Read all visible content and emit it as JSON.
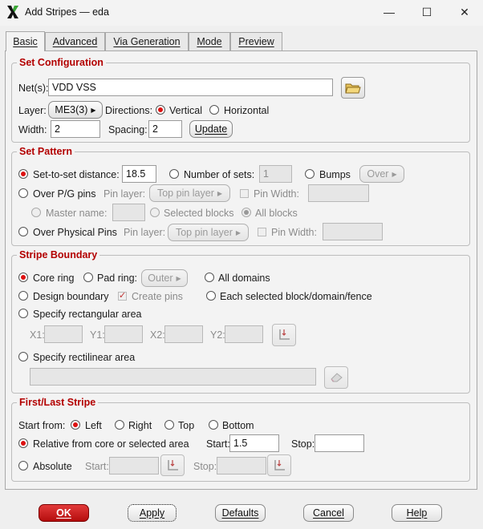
{
  "window": {
    "title": "Add Stripes — eda",
    "minimize": "—",
    "maximize": "☐",
    "close": "✕"
  },
  "tabs": [
    {
      "label": "Basic",
      "active": true
    },
    {
      "label": "Advanced",
      "active": false
    },
    {
      "label": "Via Generation",
      "active": false
    },
    {
      "label": "Mode",
      "active": false
    },
    {
      "label": "Preview",
      "active": false
    }
  ],
  "set_configuration": {
    "title": "Set Configuration",
    "nets_label": "Net(s):",
    "nets_value": "VDD VSS",
    "layer_label": "Layer:",
    "layer_value": "ME3(3)",
    "directions_label": "Directions:",
    "vertical_label": "Vertical",
    "horizontal_label": "Horizontal",
    "width_label": "Width:",
    "width_value": "2",
    "spacing_label": "Spacing:",
    "spacing_value": "2",
    "update_label": "Update"
  },
  "set_pattern": {
    "title": "Set Pattern",
    "set_to_set_label": "Set-to-set distance:",
    "set_to_set_value": "18.5",
    "number_of_sets_label": "Number of sets:",
    "number_of_sets_value": "1",
    "bumps_label": "Bumps",
    "over_label": "Over",
    "over_pg_pins_label": "Over P/G pins",
    "pin_layer_label": "Pin layer:",
    "top_pin_layer_label": "Top pin layer",
    "pin_width_label": "Pin Width:",
    "master_name_label": "Master name:",
    "selected_blocks_label": "Selected blocks",
    "all_blocks_label": "All blocks",
    "over_physical_pins_label": "Over Physical Pins",
    "pin_layer2_label": "Pin layer:",
    "top_pin_layer2_label": "Top pin layer",
    "pin_width2_label": "Pin Width:"
  },
  "stripe_boundary": {
    "title": "Stripe Boundary",
    "core_ring_label": "Core ring",
    "pad_ring_label": "Pad ring:",
    "outer_label": "Outer",
    "all_domains_label": "All domains",
    "design_boundary_label": "Design boundary",
    "create_pins_label": "Create pins",
    "each_selected_label": "Each selected block/domain/fence",
    "specify_rect_label": "Specify rectangular area",
    "x1_label": "X1:",
    "y1_label": "Y1:",
    "x2_label": "X2:",
    "y2_label": "Y2:",
    "specify_rectilinear_label": "Specify rectilinear area"
  },
  "first_last_stripe": {
    "title": "First/Last Stripe",
    "start_from_label": "Start from:",
    "left_label": "Left",
    "right_label": "Right",
    "top_label": "Top",
    "bottom_label": "Bottom",
    "relative_label": "Relative from core or selected area",
    "start_label": "Start:",
    "start_value": "1.5",
    "stop_label": "Stop:",
    "stop_value": "",
    "absolute_label": "Absolute",
    "abs_start_label": "Start:",
    "abs_stop_label": "Stop:"
  },
  "footer": {
    "ok": "OK",
    "apply": "Apply",
    "defaults": "Defaults",
    "cancel": "Cancel",
    "help": "Help"
  },
  "colors": {
    "accent_red": "#b30000",
    "ok_red": "#c41e1e"
  }
}
